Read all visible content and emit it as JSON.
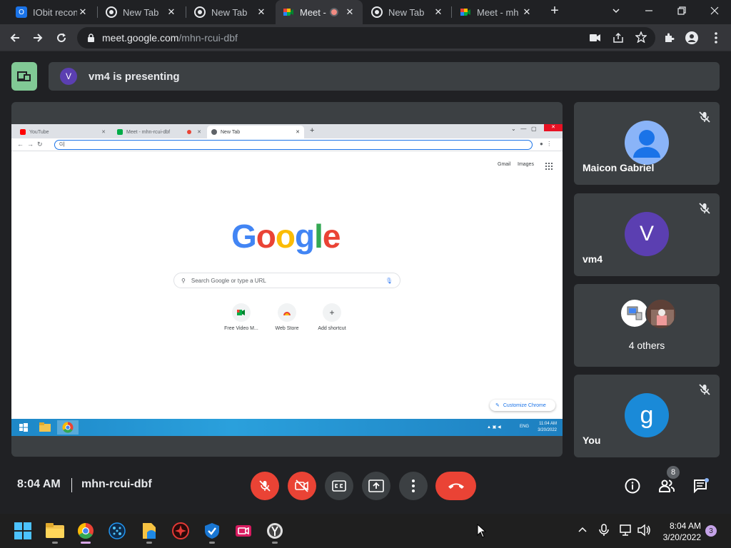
{
  "browser": {
    "tabs": [
      {
        "label": "IObit recon",
        "favicon": "iobit-icon"
      },
      {
        "label": "New Tab",
        "favicon": "chrome-icon"
      },
      {
        "label": "New Tab",
        "favicon": "chrome-icon"
      },
      {
        "label": "Meet -",
        "favicon": "meet-icon",
        "recording": true
      },
      {
        "label": "New Tab",
        "favicon": "chrome-icon"
      },
      {
        "label": "Meet - mh",
        "favicon": "meet-icon"
      }
    ],
    "new_tab_symbol": "+",
    "close_symbol": "✕",
    "url_domain": "meet.google.com",
    "url_path": "/mhn-rcui-dbf"
  },
  "meet": {
    "presenter_initial": "V",
    "presenting_text": "vm4 is presenting",
    "time": "8:04 AM",
    "meeting_code": "mhn-rcui-dbf",
    "people_count": "8",
    "participants": [
      {
        "name": "Maicon Gabriel",
        "avatar": "person-icon",
        "avatar_color": "#8ab4f8",
        "muted": true
      },
      {
        "name": "vm4",
        "initial": "V",
        "avatar_color": "#5b3fb1",
        "muted": true
      },
      {
        "name": "4 others",
        "avatar": "group-avatars",
        "muted": false
      },
      {
        "name": "You",
        "initial": "g",
        "avatar_color": "#1a8ad8",
        "muted": true
      }
    ]
  },
  "shared_screen": {
    "tabs": [
      "YouTube",
      "Meet - mhn-rcui-dbf",
      "New Tab"
    ],
    "omnibox_text": "G",
    "top_links": [
      "Gmail",
      "Images"
    ],
    "logo_text": "Google",
    "search_placeholder": "Search Google or type a URL",
    "shortcuts": [
      "Free Video M...",
      "Web Store",
      "Add shortcut"
    ],
    "customize_label": "Customize Chrome",
    "lang": "ENG",
    "clock_time": "11:04 AM",
    "clock_date": "3/20/2022"
  },
  "taskbar": {
    "time": "8:04 AM",
    "date": "3/20/2022",
    "notifications": "3"
  },
  "colors": {
    "accent_red": "#ea4335",
    "present_green": "#81c995",
    "tile_bg": "#3c4043"
  }
}
